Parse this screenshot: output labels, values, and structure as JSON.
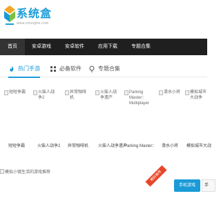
{
  "logo": {
    "title": "系统盒",
    "url": "www.xitonghe.com"
  },
  "nav": {
    "items": [
      {
        "label": "首页",
        "active": true
      },
      {
        "label": "安卓游戏",
        "active": false
      },
      {
        "label": "安卓软件",
        "active": false
      },
      {
        "label": "应用下载",
        "active": false
      },
      {
        "label": "专题合集",
        "active": false
      }
    ]
  },
  "tabs": [
    {
      "label": "热门手游",
      "icon": "fire-icon",
      "active": true
    },
    {
      "label": "必备软件",
      "icon": "grid-icon",
      "active": false
    },
    {
      "label": "专题合集",
      "icon": "pin-icon",
      "active": false
    }
  ],
  "games": [
    {
      "img_alt": "短短争霸",
      "name": "短短争霸"
    },
    {
      "img_alt": "火柴人战争2",
      "name": "火柴人战争2"
    },
    {
      "img_alt": "异常咖啡机",
      "name": "异常咖啡机"
    },
    {
      "img_alt": "火柴人战争遗产",
      "name": "火柴人战争遗产"
    },
    {
      "img_alt": "Parking Master：Multiplayer",
      "name": "Parking Master："
    },
    {
      "img_alt": "滑水小将",
      "name": "滑水小将"
    },
    {
      "img_alt": "模拟城市大战争",
      "name": "模拟城市大战"
    }
  ],
  "promo": {
    "img_alt": "模拟小镇生活的游戏推荐",
    "ribbon": "精彩推荐",
    "button_mobile": "手机游戏",
    "button_second": "手"
  },
  "colors": {
    "accent": "#1a9bd7",
    "nav_bg": "#1f1f1f",
    "ribbon": "#e8462a"
  }
}
